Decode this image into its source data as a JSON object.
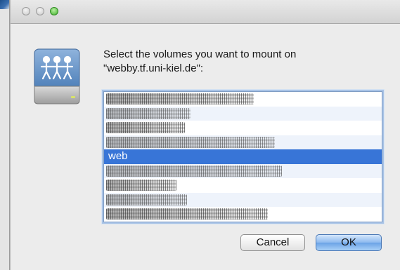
{
  "window": {
    "traffic_lights": [
      "close",
      "minimize",
      "zoom"
    ]
  },
  "dialog": {
    "icon": "network-drive-icon",
    "prompt_line1": "Select the volumes you want to mount on",
    "prompt_line2": "\"webby.tf.uni-kiel.de\":",
    "volumes": [
      {
        "label": "",
        "redacted": true
      },
      {
        "label": "",
        "redacted": true
      },
      {
        "label": "",
        "redacted": true
      },
      {
        "label": "",
        "redacted": true
      },
      {
        "label": "web",
        "redacted": false,
        "selected": true
      },
      {
        "label": "",
        "redacted": true
      },
      {
        "label": "",
        "redacted": true
      },
      {
        "label": "",
        "redacted": true
      },
      {
        "label": "",
        "redacted": true
      }
    ],
    "cancel_label": "Cancel",
    "ok_label": "OK"
  },
  "colors": {
    "selection": "#3875d7",
    "default_button": "#6aa2e6",
    "window_bg": "#ececec"
  }
}
